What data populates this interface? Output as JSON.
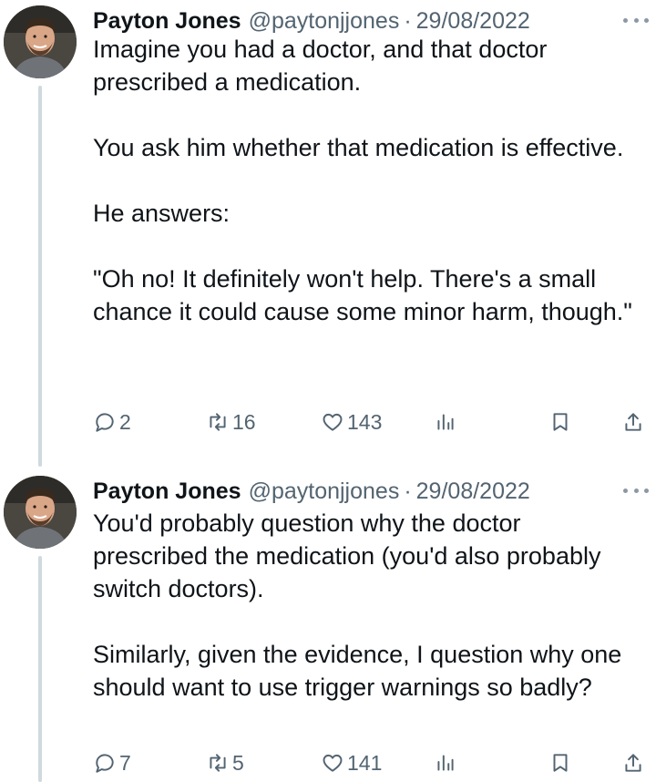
{
  "tweets": [
    {
      "author": {
        "name": "Payton Jones",
        "handle": "@paytonjjones",
        "separator": "·",
        "date": "29/08/2022"
      },
      "paragraphs": [
        "Imagine you had a doctor, and that doctor prescribed a medication.",
        "You ask him whether that medication is effective.",
        "He answers:",
        "\"Oh no! It definitely won't help. There's a small chance it could cause some minor harm, though.\""
      ],
      "stats": {
        "replies": "2",
        "retweets": "16",
        "likes": "143"
      }
    },
    {
      "author": {
        "name": "Payton Jones",
        "handle": "@paytonjjones",
        "separator": "·",
        "date": "29/08/2022"
      },
      "paragraphs": [
        "You'd probably question why the doctor prescribed the medication (you'd also probably switch doctors).",
        "Similarly, given the evidence, I question why one should want to use trigger warnings so badly?"
      ],
      "stats": {
        "replies": "7",
        "retweets": "5",
        "likes": "141"
      }
    }
  ],
  "icons": {
    "more": "more-horizontal-icon",
    "reply": "reply-bubble-icon",
    "retweet": "retweet-icon",
    "like": "heart-icon",
    "views": "bar-chart-icon",
    "bookmark": "bookmark-icon",
    "share": "share-upload-icon"
  },
  "colors": {
    "text": "#0f1419",
    "secondary": "#536471",
    "thread_line": "#cfd9de",
    "background": "#ffffff"
  }
}
